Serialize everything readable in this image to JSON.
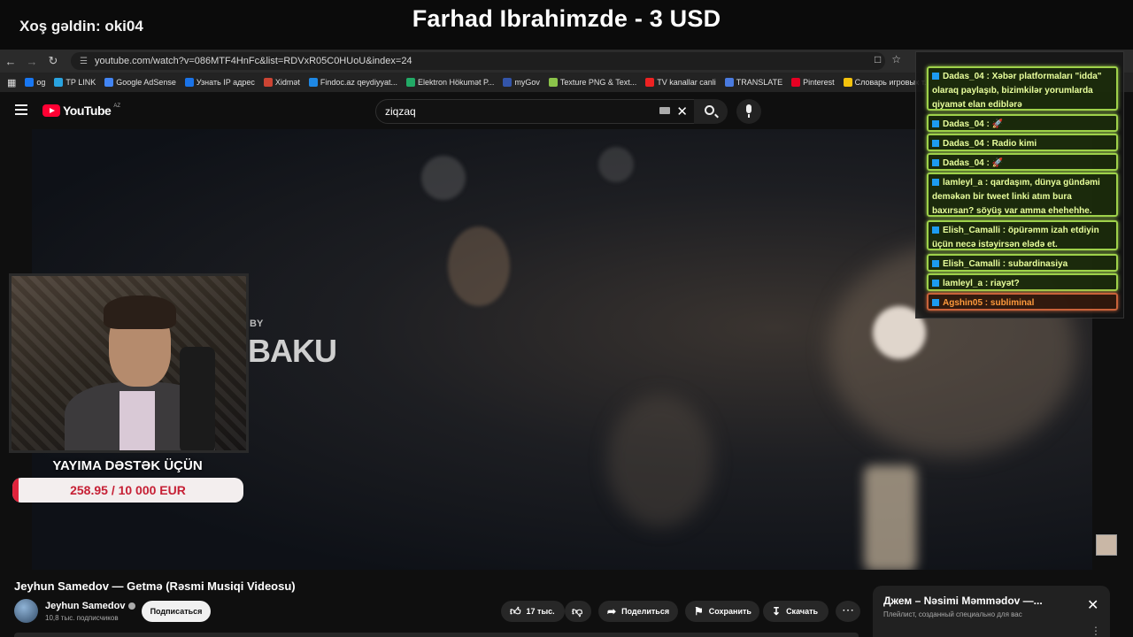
{
  "overlay": {
    "welcome": "Xoş gəldin: oki04",
    "donation_title": "Farhad Ibrahimzde - 3 USD"
  },
  "browser": {
    "url": "youtube.com/watch?v=086MTF4HnFc&list=RDVxR05C0HUoU&index=24",
    "bookmarks": [
      "og",
      "TP LINK",
      "Google AdSense",
      "Узнать IP адрес",
      "Xidmət",
      "Findoc.az qeydiyyat...",
      "Elektron Hökumət P...",
      "myGov",
      "Texture PNG & Text...",
      "TV kanallar canli",
      "TRANSLATE",
      "Pinterest",
      "Словарь игровых т..."
    ],
    "bookmark_colors": [
      "#1877f2",
      "#29a3e0",
      "#4285f4",
      "#1a73e8",
      "#c43",
      "#1e88e5",
      "#2a6",
      "#35a",
      "#8bc34a",
      "#e22",
      "#4a7be0",
      "#e60023",
      "#f4c20d"
    ]
  },
  "youtube": {
    "logo_text": "YouTube",
    "country_code": "AZ",
    "search_value": "ziqzaq"
  },
  "video": {
    "overlay_by": "BY",
    "overlay_text": "BAKU"
  },
  "stream_support": {
    "title": "YAYIMA DƏSTƏK ÜÇÜN",
    "amount_text": "258.95 / 10 000 EUR",
    "progress_fraction": 0.0259
  },
  "chat": {
    "messages": [
      {
        "text": "Dadas_04 : Xəbər platformaları \"idda\" olaraq paylaşıb, bizimkilər yorumlarda qiyamət elan ediblərə"
      },
      {
        "text": "Dadas_04 : 🚀"
      },
      {
        "text": "Dadas_04 : Radio kimi"
      },
      {
        "text": "Dadas_04 : 🚀"
      },
      {
        "text": "lamleyl_a : qardaşım, dünya gündəmi deməkən bir tweet linki atım bura baxırsan? söyüş var amma ehehehhe."
      },
      {
        "text": "Elish_Camalli : öpürəmm izah etdiyin üçün necə istəyirsən elədə et."
      },
      {
        "text": "Elish_Camalli : subardinasiya"
      },
      {
        "text": "lamleyl_a : riayət?"
      },
      {
        "text": "Agshin05 : subliminal"
      }
    ]
  },
  "below": {
    "title": "Jeyhun Samedov — Getmə (Rəsmi Musiqi Videosu)",
    "channel_name": "Jeyhun Samedov",
    "subscribers": "10,8 тыс. подписчиков",
    "subscribe_label": "Подписаться",
    "likes": "17 тыс.",
    "share_label": "Поделиться",
    "save_label": "Сохранить",
    "download_label": "Скачать"
  },
  "playlist": {
    "title": "Джем – Nəsimi Məmmədov —...",
    "subtitle": "Плейлист, созданный специально для вас"
  }
}
